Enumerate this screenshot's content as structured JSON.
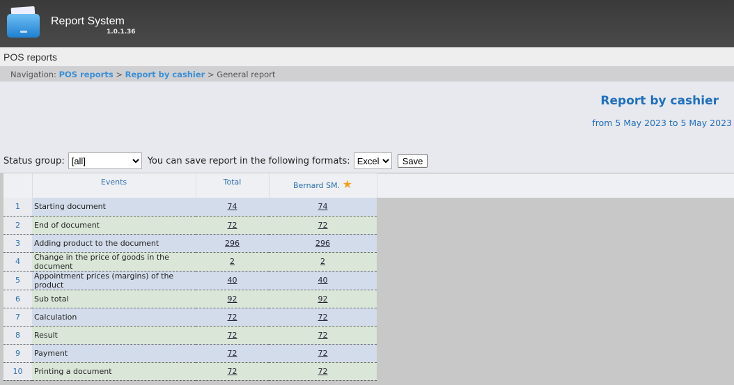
{
  "app": {
    "title": "Report System",
    "version": "1.0.1.36"
  },
  "section": "POS reports",
  "nav": {
    "label": "Navigation:",
    "items": [
      "POS reports",
      "Report by cashier",
      "General report"
    ],
    "sep": ">"
  },
  "report": {
    "title": "Report by cashier",
    "date_range": "from 5 May 2023 to 5 May 2023"
  },
  "controls": {
    "status_label": "Status group:",
    "status_value": "[all]",
    "formats_label": "You can save report in the following formats:",
    "format_value": "Excel",
    "save_label": "Save"
  },
  "table": {
    "headers": [
      "Events",
      "Total",
      "Bernard SM."
    ],
    "rows": [
      {
        "n": "1",
        "event": "Starting document",
        "total": "74",
        "cashier": "74"
      },
      {
        "n": "2",
        "event": "End of document",
        "total": "72",
        "cashier": "72"
      },
      {
        "n": "3",
        "event": "Adding product to the document",
        "total": "296",
        "cashier": "296"
      },
      {
        "n": "4",
        "event": "Change in the price of goods in the document",
        "total": "2",
        "cashier": "2"
      },
      {
        "n": "5",
        "event": "Appointment prices (margins) of the product",
        "total": "40",
        "cashier": "40"
      },
      {
        "n": "6",
        "event": "Sub total",
        "total": "92",
        "cashier": "92"
      },
      {
        "n": "7",
        "event": "Calculation",
        "total": "72",
        "cashier": "72"
      },
      {
        "n": "8",
        "event": "Result",
        "total": "72",
        "cashier": "72"
      },
      {
        "n": "9",
        "event": "Payment",
        "total": "72",
        "cashier": "72"
      },
      {
        "n": "10",
        "event": "Printing a document",
        "total": "72",
        "cashier": "72"
      }
    ]
  }
}
